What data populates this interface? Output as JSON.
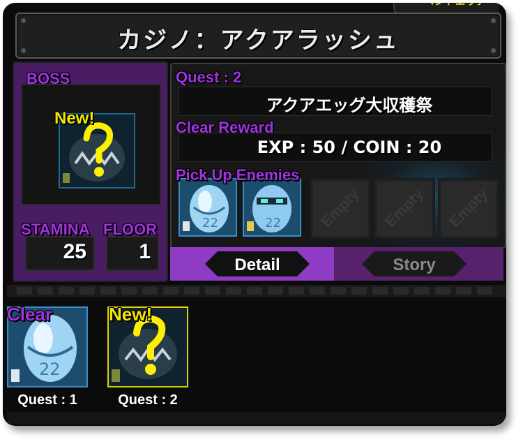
{
  "top_tab": {
    "label": "ベントエリア"
  },
  "title": "カジノ：アクアラッシュ",
  "boss": {
    "label": "BOSS",
    "new_badge": "New!",
    "stamina_label": "STAMINA",
    "stamina_value": "25",
    "floor_label": "FLOOR",
    "floor_value": "1"
  },
  "quest": {
    "quest_label": "Quest : 2",
    "quest_name": "アクアエッグ大収穫祭",
    "reward_label": "Clear Reward",
    "reward_value": "EXP : 50 / COIN : 20",
    "pickup_label": "Pick Up Enemies",
    "empty_label": "Empty",
    "empty_slots": [
      "Empty",
      "Empty",
      "Empty"
    ]
  },
  "tabs": {
    "detail": "Detail",
    "story": "Story"
  },
  "quest_list": [
    {
      "badge": "Clear",
      "caption": "Quest : 1"
    },
    {
      "badge": "New!",
      "caption": "Quest : 2"
    }
  ],
  "colors": {
    "panel_purple": "#4a1c63",
    "label_purple": "#a034e0",
    "new_yellow": "#f5e600",
    "tab_active": "#8f3cc5"
  },
  "icons": {
    "unknown": "question-mark-icon",
    "egg": "aqua-egg-monster-icon"
  }
}
